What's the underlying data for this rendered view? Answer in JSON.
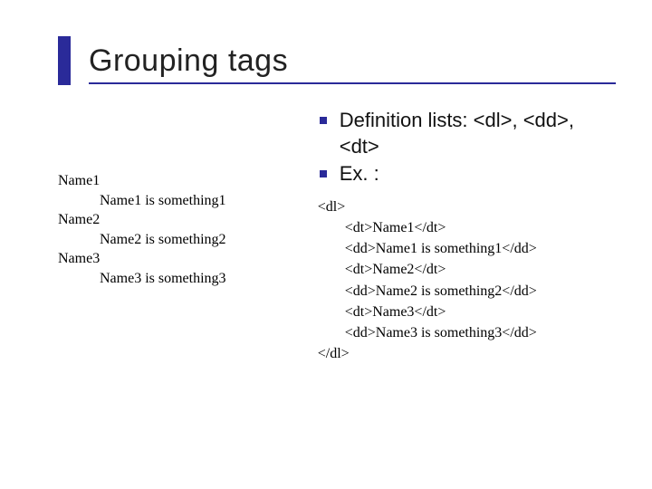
{
  "title": "Grouping tags",
  "left": {
    "dt1": "Name1",
    "dd1": "Name1 is something1",
    "dt2": "Name2",
    "dd2": "Name2 is something2",
    "dt3": "Name3",
    "dd3": "Name3 is something3"
  },
  "right": {
    "bullet1": "Definition lists: <dl>, <dd>, <dt>",
    "bullet2": "Ex. :",
    "code": {
      "open": "<dl>",
      "l1": "<dt>Name1</dt>",
      "l2": "<dd>Name1 is something1</dd>",
      "l3": "<dt>Name2</dt>",
      "l4": "<dd>Name2 is something2</dd>",
      "l5": "<dt>Name3</dt>",
      "l6": "<dd>Name3 is something3</dd>",
      "close": "</dl>"
    }
  }
}
